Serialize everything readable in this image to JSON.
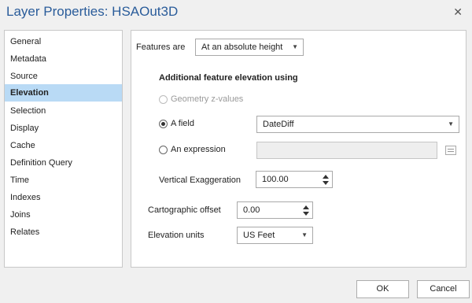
{
  "window": {
    "title": "Layer Properties: HSAOut3D",
    "close_icon": "close-icon"
  },
  "nav": {
    "items": [
      {
        "label": "General"
      },
      {
        "label": "Metadata"
      },
      {
        "label": "Source"
      },
      {
        "label": "Elevation",
        "selected": true
      },
      {
        "label": "Selection"
      },
      {
        "label": "Display"
      },
      {
        "label": "Cache"
      },
      {
        "label": "Definition Query"
      },
      {
        "label": "Time"
      },
      {
        "label": "Indexes"
      },
      {
        "label": "Joins"
      },
      {
        "label": "Relates"
      }
    ]
  },
  "elevation": {
    "features_are_label": "Features are",
    "features_are_value": "At an absolute height",
    "additional_label": "Additional feature elevation using",
    "options": {
      "geometry": "Geometry z-values",
      "field": "A field",
      "expression": "An expression"
    },
    "selected_option": "field",
    "field_value": "DateDiff",
    "expression_value": "",
    "vertical_exaggeration_label": "Vertical Exaggeration",
    "vertical_exaggeration_value": "100.00",
    "cartographic_offset_label": "Cartographic offset",
    "cartographic_offset_value": "0.00",
    "elevation_units_label": "Elevation units",
    "elevation_units_value": "US Feet"
  },
  "buttons": {
    "ok": "OK",
    "cancel": "Cancel"
  },
  "colors": {
    "title": "#2a5c9a",
    "selected_nav": "#b9daf5",
    "background": "#f0f0f0"
  }
}
